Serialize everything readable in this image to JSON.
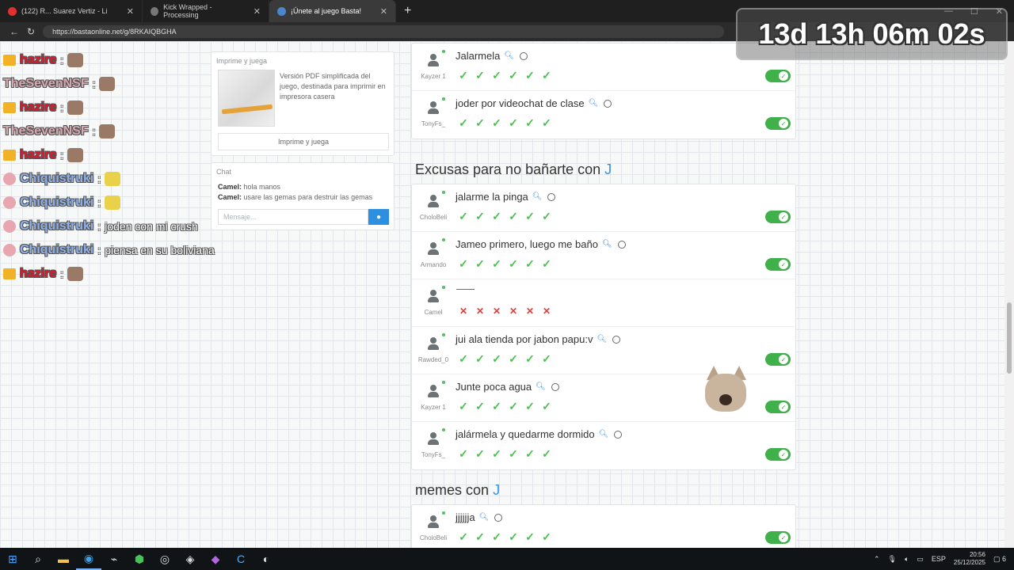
{
  "browser": {
    "tabs": [
      {
        "label": "(122) R... Suarez Vertiz - Li"
      },
      {
        "label": "Kick Wrapped - Processing"
      },
      {
        "label": "¡Únete al juego Basta!",
        "active": true
      }
    ],
    "new_tab": "+",
    "url": "https://bastaonline.net/g/8RKAIQBGHA"
  },
  "sidebar": {
    "print": {
      "title": "Imprime y juega",
      "description": "Versión PDF simplificada del juego, destinada para imprimir en impresora casera",
      "button": "Imprime y juega"
    },
    "chat": {
      "title": "Chat",
      "messages": [
        {
          "user": "Camel:",
          "text": "hola manos"
        },
        {
          "user": "Camel:",
          "text": "usare las gemas para destruir las gemas"
        }
      ],
      "placeholder": "Mensaje..."
    }
  },
  "sections": [
    {
      "title": "",
      "letter": "",
      "rows": [
        {
          "answer": "Jalarmela",
          "player": "Kayzer 1",
          "votes": [
            "ok",
            "ok",
            "ok",
            "ok",
            "ok",
            "ok"
          ],
          "valid": true
        },
        {
          "answer": "joder por videochat de clase",
          "player": "TonyFs_",
          "votes": [
            "ok",
            "ok",
            "ok",
            "ok",
            "ok",
            "ok"
          ],
          "valid": true
        }
      ]
    },
    {
      "title": "Excusas para no bañarte con",
      "letter": "J",
      "rows": [
        {
          "answer": "jalarme la pinga",
          "player": "CholoBeli",
          "votes": [
            "ok",
            "ok",
            "ok",
            "ok",
            "ok",
            "ok"
          ],
          "valid": true
        },
        {
          "answer": "Jameo primero, luego me baño",
          "player": "Armando",
          "votes": [
            "ok",
            "ok",
            "ok",
            "ok",
            "ok",
            "ok"
          ],
          "valid": true
        },
        {
          "answer": "",
          "player": "Camel",
          "votes": [
            "no",
            "no",
            "no",
            "no",
            "no",
            "no"
          ],
          "valid": false
        },
        {
          "answer": "jui ala tienda por jabon papu:v",
          "player": "Rawded_0",
          "votes": [
            "ok",
            "ok",
            "ok",
            "ok",
            "ok",
            "ok"
          ],
          "valid": true
        },
        {
          "answer": "Junte poca agua",
          "player": "Kayzer 1",
          "votes": [
            "ok",
            "ok",
            "ok",
            "ok",
            "ok",
            "ok"
          ],
          "valid": true
        },
        {
          "answer": "jalármela y quedarme dormido",
          "player": "TonyFs_",
          "votes": [
            "ok",
            "ok",
            "ok",
            "ok",
            "ok",
            "ok"
          ],
          "valid": true
        }
      ]
    },
    {
      "title": "memes con",
      "letter": "J",
      "rows": [
        {
          "answer": "jjjjjja",
          "player": "CholoBeli",
          "votes": [
            "ok",
            "ok",
            "ok",
            "ok",
            "ok",
            "ok"
          ],
          "valid": true
        }
      ]
    }
  ],
  "overlay": {
    "timer": "13d 13h 06m 02s",
    "chat": [
      {
        "user": "hazire",
        "color": "#e0162b",
        "badge": "crown",
        "msg": ""
      },
      {
        "user": "TheSevenNSF",
        "color": "#d8a7b1",
        "badge": "",
        "msg": ""
      },
      {
        "user": "hazire",
        "color": "#e0162b",
        "badge": "crown",
        "msg": ""
      },
      {
        "user": "TheSevenNSF",
        "color": "#d8a7b1",
        "badge": "",
        "msg": ""
      },
      {
        "user": "hazire",
        "color": "#e0162b",
        "badge": "crown",
        "msg": ""
      },
      {
        "user": "Chiquistruki",
        "color": "#8fb0e8",
        "badge": "pink",
        "msg": ""
      },
      {
        "user": "Chiquistruki",
        "color": "#8fb0e8",
        "badge": "pink",
        "msg": ""
      },
      {
        "user": "Chiquistruki",
        "color": "#8fb0e8",
        "badge": "pink",
        "msg": "joden con mi crush"
      },
      {
        "user": "Chiquistruki",
        "color": "#8fb0e8",
        "badge": "pink",
        "msg": "piensa en su boliviana"
      },
      {
        "user": "hazire",
        "color": "#e0162b",
        "badge": "crown",
        "msg": ""
      }
    ]
  },
  "taskbar": {
    "lang": "ESP",
    "time": "20:56",
    "date": "25/12/2025",
    "notif": "6"
  },
  "colors": {
    "accent": "#3392e6",
    "valid": "#3fb04a",
    "invalid": "#e23b3b"
  }
}
